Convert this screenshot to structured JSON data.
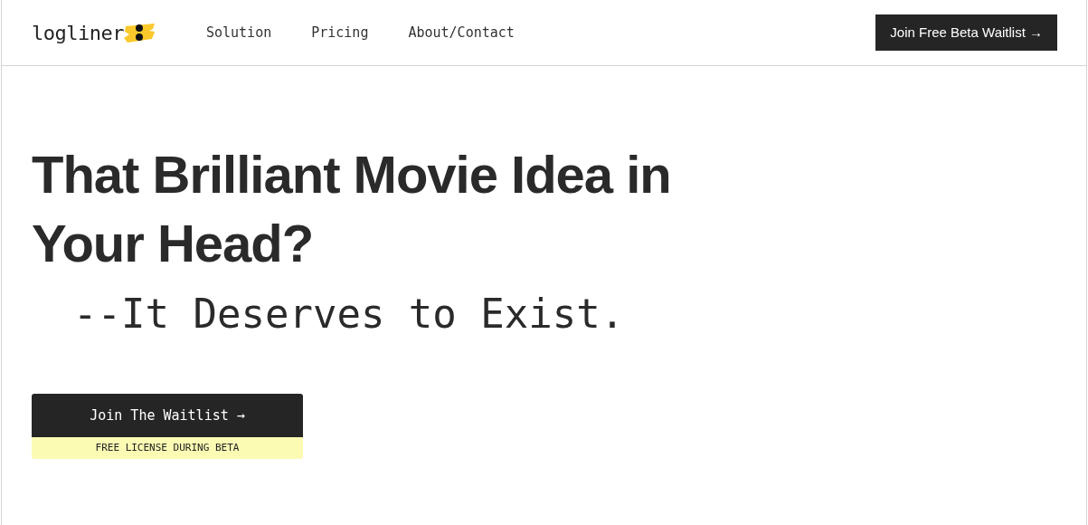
{
  "header": {
    "logo": "logliner",
    "nav": [
      "Solution",
      "Pricing",
      "About/Contact"
    ],
    "cta": "Join Free Beta Waitlist →"
  },
  "hero": {
    "headline_lines": [
      "That Brilliant Movie Idea in",
      "Your Head?"
    ],
    "subline": "--It Deserves to Exist.",
    "button": "Join The Waitlist →",
    "note": "FREE LICENSE DURING BETA"
  }
}
